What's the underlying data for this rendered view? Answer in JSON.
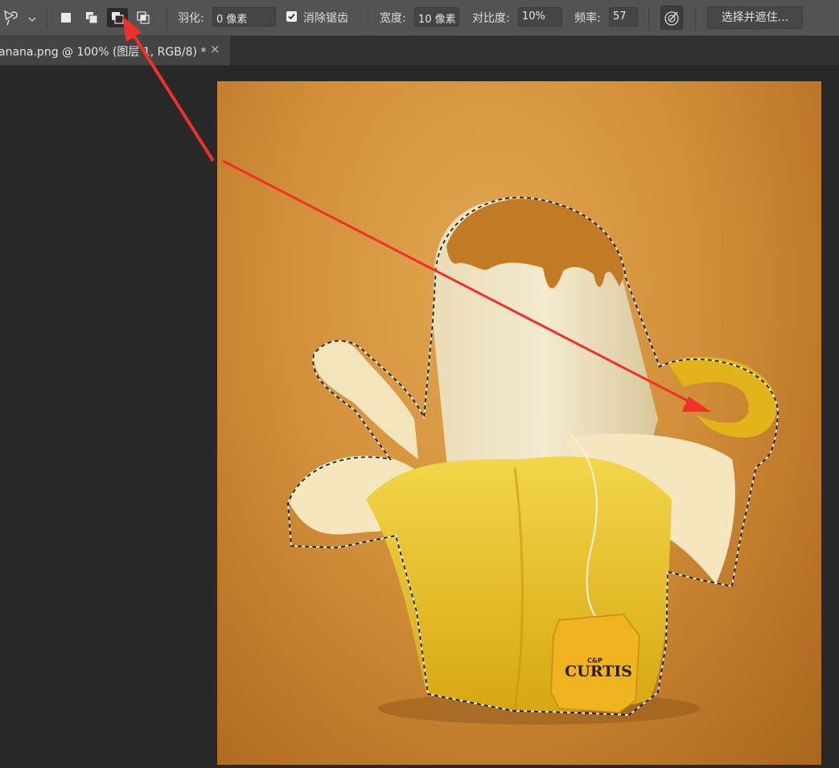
{
  "options_bar": {
    "feather_label": "羽化:",
    "feather_value": "0 像素",
    "antialias_label": "消除锯齿",
    "antialias_checked": true,
    "width_label": "宽度:",
    "width_value": "10 像素",
    "contrast_label": "对比度:",
    "contrast_value": "10%",
    "frequency_label": "频率:",
    "frequency_value": "57",
    "select_and_mask_label": "选择并遮住...",
    "active_mode": "subtract-from-selection"
  },
  "document_tab": {
    "title": "anana.png @ 100% (图层 1, RGB/8) *",
    "close_glyph": "×"
  },
  "canvas": {
    "tea_tag_brand": "CURTIS",
    "tea_tag_monogram": "C&P"
  },
  "colors": {
    "annotation_arrow": "#f0312a",
    "options_bar_bg": "#535353",
    "workspace_bg": "#282828"
  }
}
